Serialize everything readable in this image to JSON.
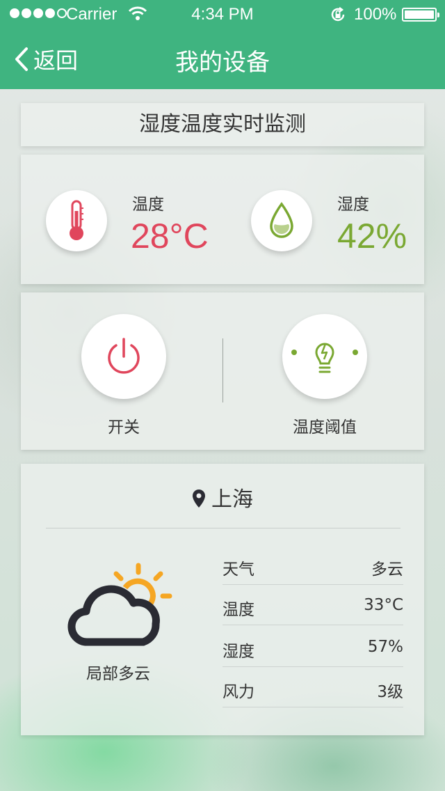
{
  "status_bar": {
    "carrier": "Carrier",
    "time": "4:34 PM",
    "battery": "100%"
  },
  "nav": {
    "back_label": "返回",
    "title": "我的设备"
  },
  "monitor": {
    "section_title": "湿度温度实时监测",
    "temperature": {
      "label": "温度",
      "value": "28°C",
      "color": "#e0465c",
      "icon": "thermometer-icon"
    },
    "humidity": {
      "label": "湿度",
      "value": "42%",
      "color": "#7aa832",
      "icon": "water-drop-icon"
    }
  },
  "controls": {
    "power": {
      "label": "开关",
      "icon": "power-icon",
      "color": "#e0465c"
    },
    "threshold": {
      "label": "温度阈值",
      "icon": "lightbulb-icon",
      "color": "#7aa832"
    }
  },
  "weather": {
    "city": "上海",
    "description": "局部多云",
    "icon": "partly-cloudy-icon",
    "rows": [
      {
        "key": "天气",
        "value": "多云"
      },
      {
        "key": "温度",
        "value": "33°C"
      },
      {
        "key": "湿度",
        "value": "57%"
      },
      {
        "key": "风力",
        "value": "3级"
      }
    ]
  },
  "colors": {
    "accent": "#3fb480",
    "sun": "#f5a623",
    "cloud": "#2a2b33"
  }
}
